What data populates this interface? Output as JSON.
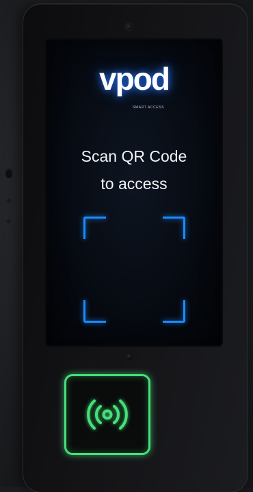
{
  "device": {
    "brand": "vpod",
    "brand_tagline": "SMART ACCESS",
    "prompt_line1": "Scan QR Code",
    "prompt_line2": "to access"
  },
  "colors": {
    "scan_frame": "#1a8cff",
    "nfc_glow": "#46e07a",
    "logo_glow": "#2878ff"
  },
  "icons": {
    "nfc": "contactless-nfc-icon"
  }
}
